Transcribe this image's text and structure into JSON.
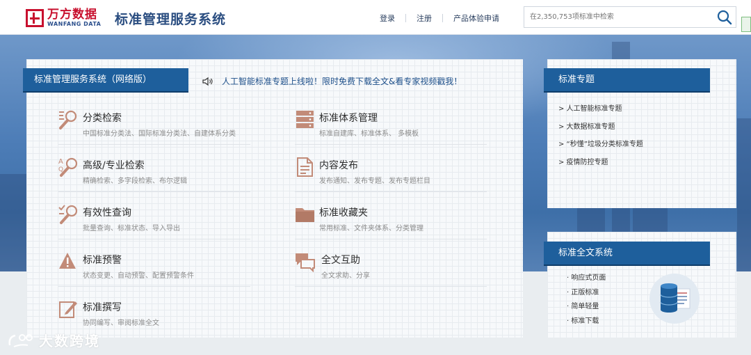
{
  "header": {
    "logo_cn": "万方数据",
    "logo_en": "WANFANG DATA",
    "site_title": "标准管理服务系统",
    "nav": {
      "login": "登录",
      "register": "注册",
      "trial": "产品体验申请"
    },
    "search_placeholder": "在2,350,753项标准中检索"
  },
  "main": {
    "panel_title": "标准管理服务系统（网络版）",
    "notice": "人工智能标准专题上线啦！限时免费下载全文&看专家视频戳我！",
    "features": [
      {
        "icon": "classify-search-icon",
        "title": "分类检索",
        "desc": "中国标准分类法、国际标准分类法、自建体系分类"
      },
      {
        "icon": "standard-system-icon",
        "title": "标准体系管理",
        "desc": "标准自建库、标准体系、 多模板"
      },
      {
        "icon": "advanced-search-icon",
        "title": "高级/专业检索",
        "desc": "精确检索、多字段检索、布尔逻辑"
      },
      {
        "icon": "content-publish-icon",
        "title": "内容发布",
        "desc": "发布通知、发布专题、发布专题栏目"
      },
      {
        "icon": "validity-query-icon",
        "title": "有效性查询",
        "desc": "批量查询、标准状态、导入导出"
      },
      {
        "icon": "folder-icon",
        "title": "标准收藏夹",
        "desc": "常用标准、文件夹体系、分类管理"
      },
      {
        "icon": "warning-icon",
        "title": "标准预警",
        "desc": "状态变更、自动预警、配置预警条件"
      },
      {
        "icon": "chat-icon",
        "title": "全文互助",
        "desc": "全文求助、分享"
      },
      {
        "icon": "edit-icon",
        "title": "标准撰写",
        "desc": "协同编写、审阅标准全文"
      }
    ]
  },
  "topics": {
    "title": "标准专题",
    "items": [
      "> 人工智能标准专题",
      "> 大数据标准专题",
      "> “秒懂”垃圾分类标准专题",
      "> 疫情防控专题"
    ]
  },
  "fulltext": {
    "title": "标准全文系统",
    "items": [
      "· 响应式页面",
      "· 正版标准",
      "· 简单轻量",
      "· 标准下载"
    ]
  },
  "watermark": "大数跨境",
  "colors": {
    "primary": "#1e5f9c",
    "brand_red": "#c8102e",
    "icon": "#c28b78"
  }
}
